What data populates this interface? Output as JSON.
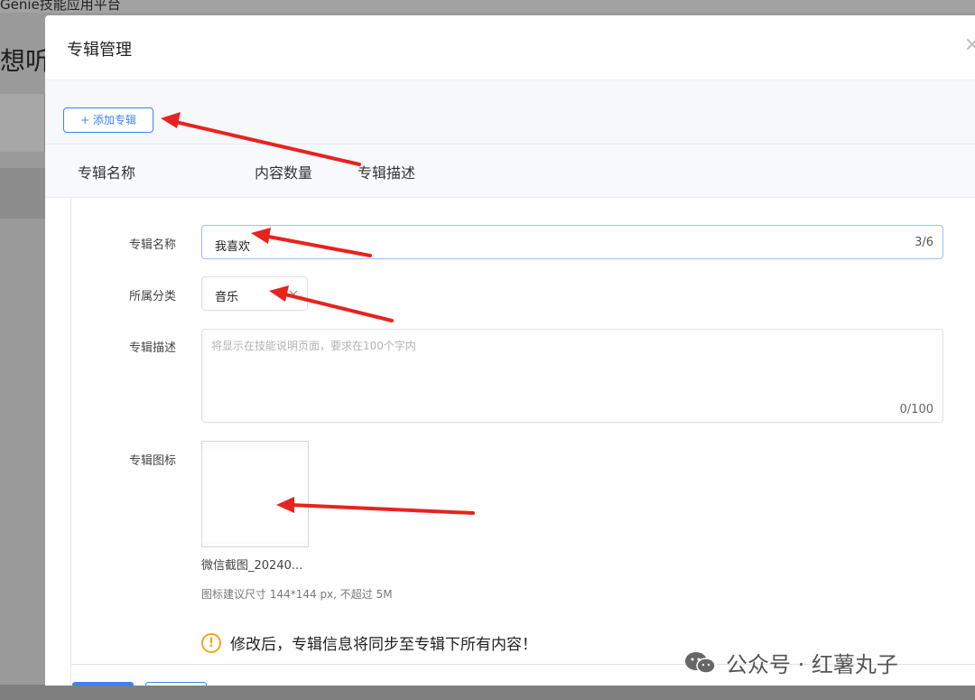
{
  "background": {
    "topbar_title": "Genie技能应用平台",
    "heading": "想听"
  },
  "modal": {
    "title": "专辑管理",
    "close_glyph": "×",
    "add_button": "+ 添加专辑",
    "columns": [
      "专辑名称",
      "内容数量",
      "专辑描述"
    ]
  },
  "form": {
    "name_label": "专辑名称",
    "name_value": "我喜欢",
    "name_count": "3/6",
    "category_label": "所属分类",
    "category_value": "音乐",
    "desc_label": "专辑描述",
    "desc_placeholder": "将显示在技能说明页面，要求在100个字内",
    "desc_count": "0/100",
    "icon_label": "专辑图标",
    "icon_file_name": "微信截图_20240...",
    "icon_hint": "图标建议尺寸 144*144 px, 不超过 5M",
    "warning": "修改后，专辑信息将同步至专辑下所有内容！"
  },
  "watermark": {
    "text": "公众号 · 红薯丸子"
  },
  "colors": {
    "primary": "#3a83f6",
    "warning": "#f0a91b",
    "arrow": "#e8231f"
  },
  "icons": {
    "warning": "warning-circle-icon",
    "chevron": "chevron-down-icon",
    "close": "close-icon",
    "wechat": "wechat-icon"
  }
}
